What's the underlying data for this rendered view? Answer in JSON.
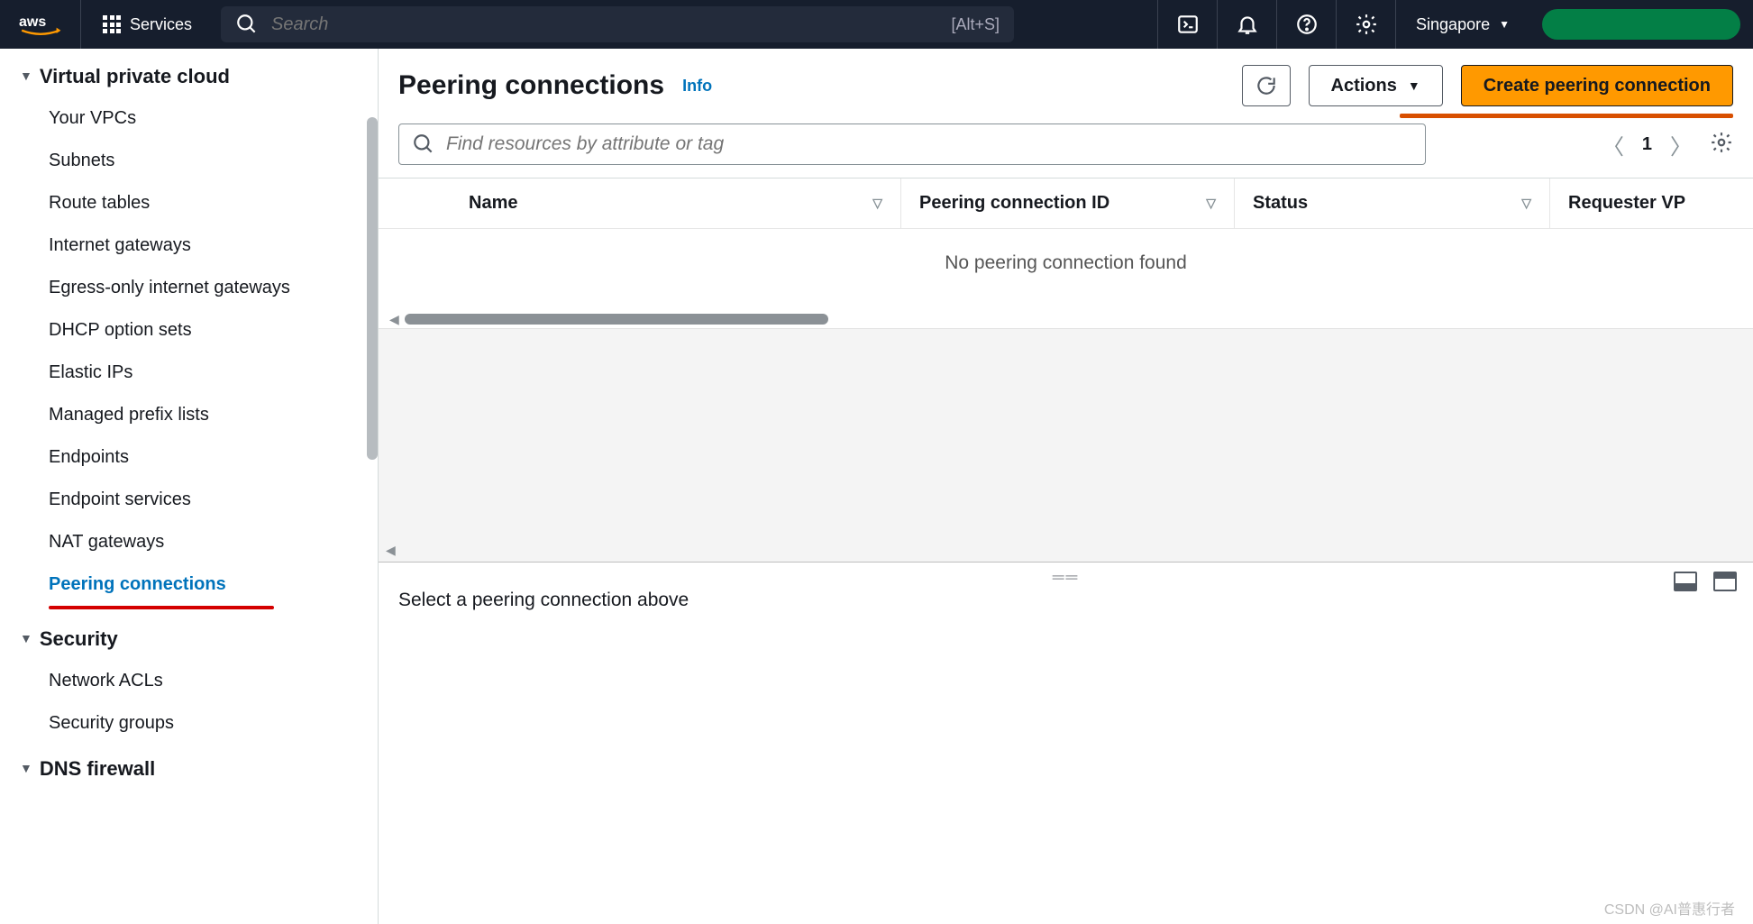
{
  "topnav": {
    "services_label": "Services",
    "search_placeholder": "Search",
    "search_shortcut": "[Alt+S]",
    "region": "Singapore"
  },
  "sidebar": {
    "groups": [
      {
        "title": "Virtual private cloud",
        "items": [
          "Your VPCs",
          "Subnets",
          "Route tables",
          "Internet gateways",
          "Egress-only internet gateways",
          "DHCP option sets",
          "Elastic IPs",
          "Managed prefix lists",
          "Endpoints",
          "Endpoint services",
          "NAT gateways",
          "Peering connections"
        ],
        "active_index": 11
      },
      {
        "title": "Security",
        "items": [
          "Network ACLs",
          "Security groups"
        ]
      },
      {
        "title": "DNS firewall",
        "items": []
      }
    ]
  },
  "page": {
    "title": "Peering connections",
    "info_label": "Info",
    "actions_label": "Actions",
    "create_label": "Create peering connection",
    "filter_placeholder": "Find resources by attribute or tag",
    "page_number": "1",
    "columns": [
      "Name",
      "Peering connection ID",
      "Status",
      "Requester VP"
    ],
    "empty_message": "No peering connection found",
    "details_message": "Select a peering connection above"
  },
  "watermark": "CSDN @AI普惠行者"
}
